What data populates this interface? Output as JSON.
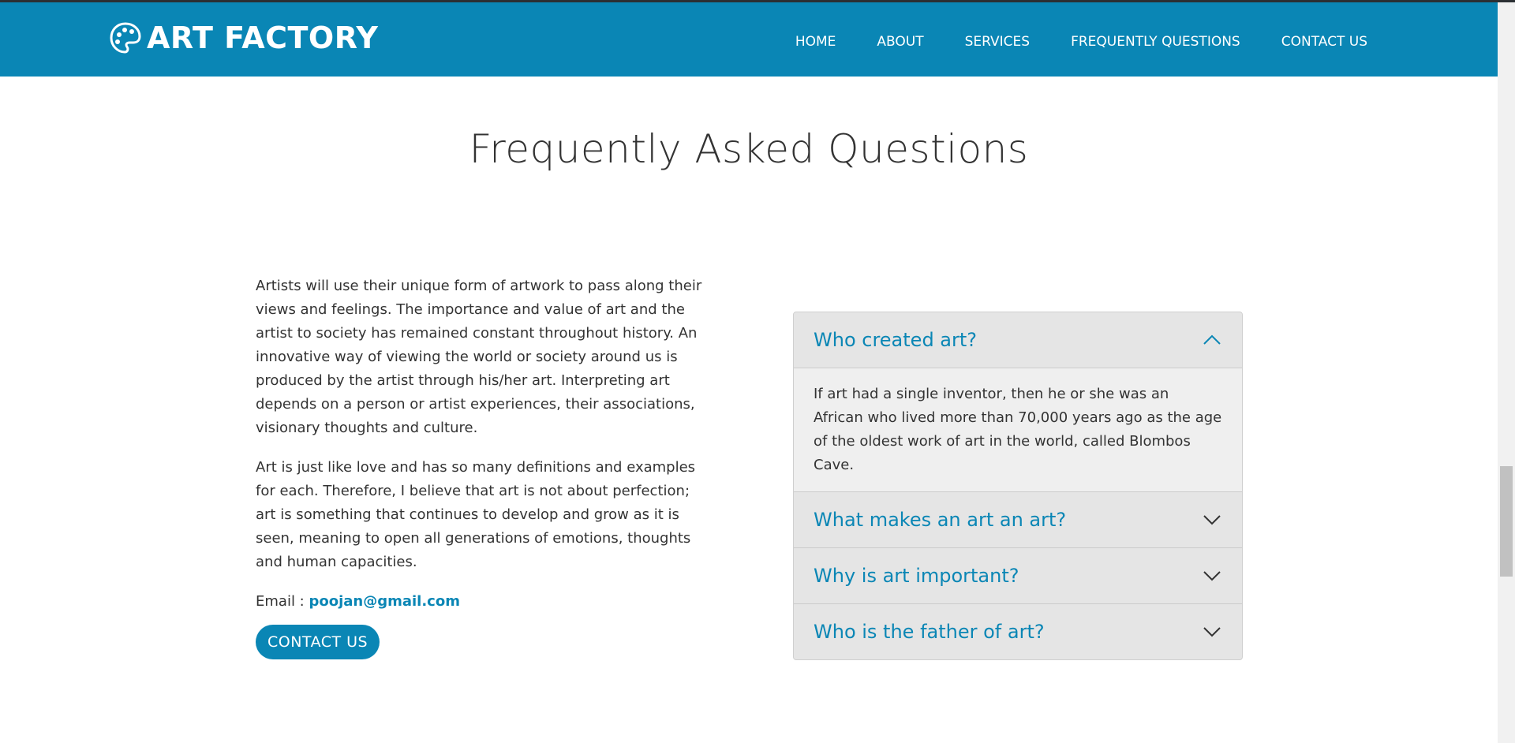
{
  "header": {
    "brand": "ART FACTORY",
    "brand_icon": "palette-icon",
    "nav": [
      {
        "label": "HOME"
      },
      {
        "label": "ABOUT"
      },
      {
        "label": "SERVICES"
      },
      {
        "label": "FREQUENTLY QUESTIONS"
      },
      {
        "label": "CONTACT US"
      }
    ],
    "bg_color": "#0a86b5"
  },
  "section": {
    "title": "Frequently Asked Questions"
  },
  "intro": {
    "paragraph1": "Artists will use their unique form of artwork to pass along their views and feelings. The importance and value of art and the artist to society has remained constant throughout history. An innovative way of viewing the world or society around us is produced by the artist through his/her art. Interpreting art depends on a person or artist experiences, their associations, visionary thoughts and culture.",
    "paragraph2": "Art is just like love and has so many definitions and examples for each. Therefore, I believe that art is not about perfection; art is something that continues to develop and grow as it is seen, meaning to open all generations of emotions, thoughts and human capacities.",
    "email_label": "Email : ",
    "email": "poojan@gmail.com",
    "contact_button": "CONTACT US"
  },
  "faq": {
    "items": [
      {
        "question": "Who created art?",
        "expanded": true,
        "answer": "If art had a single inventor, then he or she was an African who lived more than 70,000 years ago as the age of the oldest work of art in the world, called Blombos Cave."
      },
      {
        "question": "What makes an art an art?",
        "expanded": false
      },
      {
        "question": "Why is art important?",
        "expanded": false
      },
      {
        "question": "Who is the father of art?",
        "expanded": false
      }
    ],
    "icons": {
      "expanded": "chevron-up-icon",
      "collapsed": "chevron-down-icon"
    }
  }
}
